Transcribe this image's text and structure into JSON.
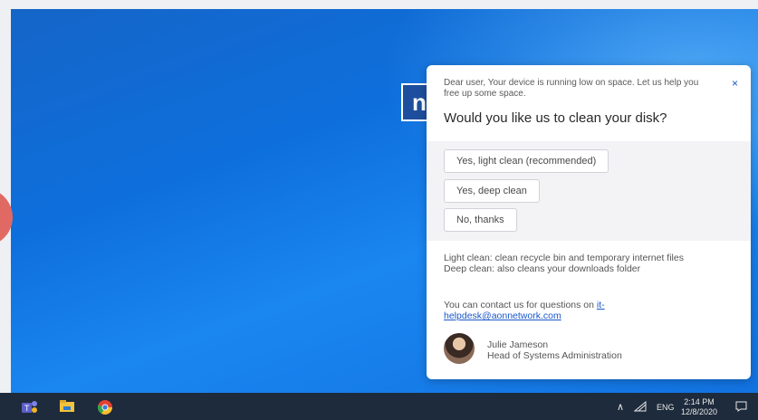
{
  "dialog": {
    "intro": "Dear user, Your device is running low on space. Let us help you free up some space.",
    "close_label": "×",
    "question": "Would you like us to clean your disk?",
    "options": [
      "Yes, light clean (recommended)",
      "Yes, deep clean",
      "No, thanks"
    ],
    "info_line1": "Light clean: clean recycle bin and temporary internet files",
    "info_line2": "Deep clean: also cleans your downloads folder",
    "contact_text": "You can contact us for questions on ",
    "contact_email": "it-helpdesk@aonnetwork.com",
    "person_name": "Julie Jameson",
    "person_title": "Head of Systems Administration"
  },
  "desktop": {
    "logo_letter": "n"
  },
  "taskbar": {
    "apps": [
      "teams-icon",
      "file-explorer-icon",
      "chrome-icon"
    ],
    "tray_up": "∧",
    "language": "ENG",
    "time": "2:14 PM",
    "date": "12/8/2020"
  },
  "colors": {
    "accent": "#1a56c9",
    "taskbar": "#1e2b3c",
    "desktop": "#0e6fdc"
  }
}
